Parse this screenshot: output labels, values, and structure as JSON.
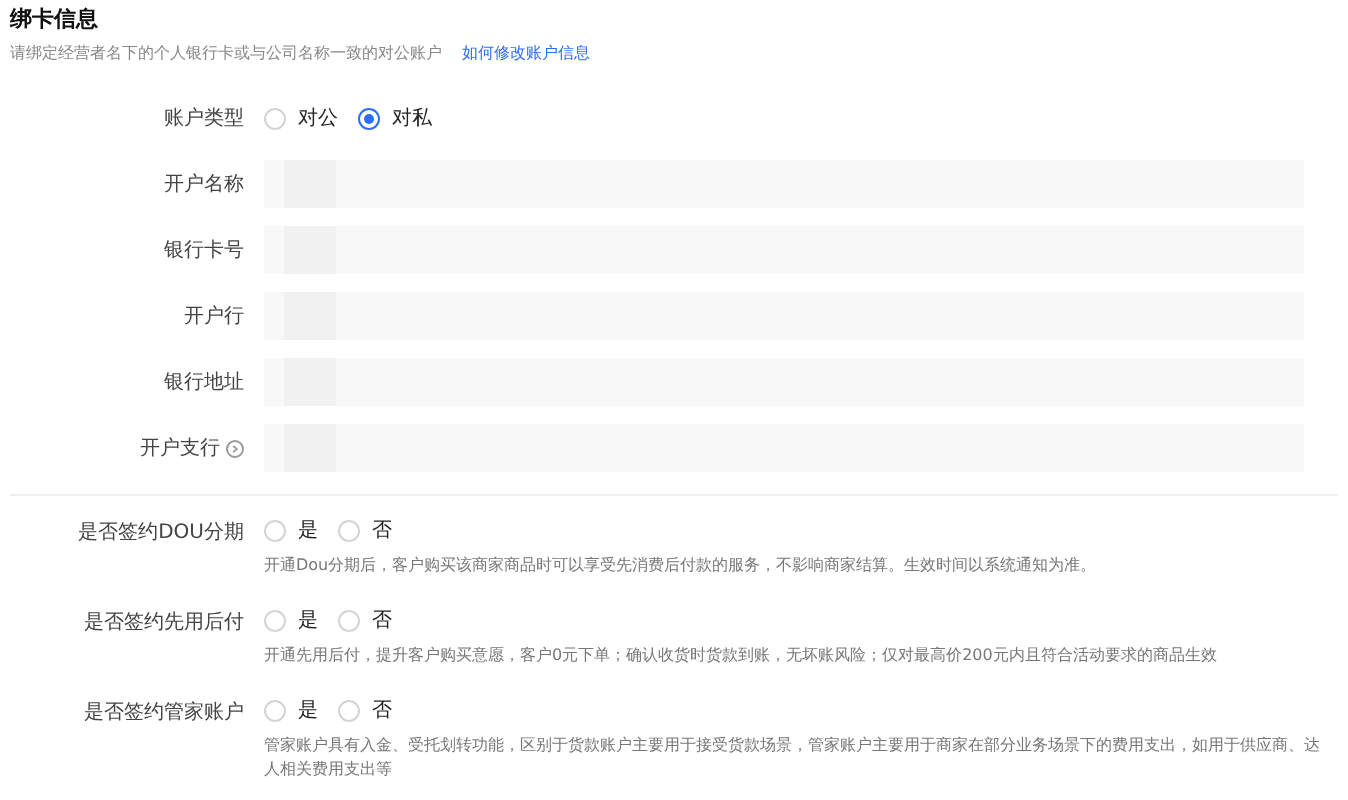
{
  "section": {
    "title": "绑卡信息",
    "subtitle": "请绑定经营者名下的个人银行卡或与公司名称一致的对公账户",
    "link": "如何修改账户信息"
  },
  "account_type": {
    "label": "账户类型",
    "options": [
      {
        "label": "对公",
        "selected": false
      },
      {
        "label": "对私",
        "selected": true
      }
    ]
  },
  "fields": [
    {
      "label": "开户名称",
      "help": false
    },
    {
      "label": "银行卡号",
      "help": false
    },
    {
      "label": "开户行",
      "help": false
    },
    {
      "label": "银行地址",
      "help": false
    },
    {
      "label": "开户支行",
      "help": true
    }
  ],
  "agreements": [
    {
      "label": "是否签约DOU分期",
      "options": [
        {
          "label": "是",
          "selected": false
        },
        {
          "label": "否",
          "selected": false
        }
      ],
      "description": "开通Dou分期后，客户购买该商家商品时可以享受先消费后付款的服务，不影响商家结算。生效时间以系统通知为准。"
    },
    {
      "label": "是否签约先用后付",
      "options": [
        {
          "label": "是",
          "selected": false
        },
        {
          "label": "否",
          "selected": false
        }
      ],
      "description": "开通先用后付，提升客户购买意愿，客户0元下单；确认收货时货款到账，无坏账风险；仅对最高价200元内且符合活动要求的商品生效"
    },
    {
      "label": "是否签约管家账户",
      "options": [
        {
          "label": "是",
          "selected": false
        },
        {
          "label": "否",
          "selected": false
        }
      ],
      "description": "管家账户具有入金、受托划转功能，区别于货款账户主要用于接受货款场景，管家账户主要用于商家在部分业务场景下的费用支出，如用于供应商、达人相关费用支出等"
    }
  ]
}
